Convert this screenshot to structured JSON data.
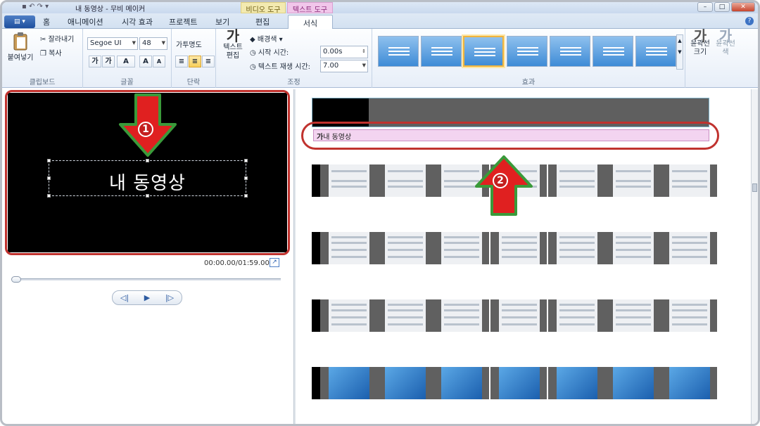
{
  "window": {
    "title": "내 동영상 - 무비 메이커",
    "quick_access": "▪ ↶ ↷ ▾",
    "controls": {
      "min": "–",
      "max": "□",
      "close": "✕"
    }
  },
  "context_tabs": {
    "video": "비디오 도구",
    "text": "텍스트 도구"
  },
  "tabs": [
    "홈",
    "애니메이션",
    "시각 효과",
    "프로젝트",
    "보기",
    "편집",
    "서식"
  ],
  "active_tab": "서식",
  "file_button": "▤ ▾",
  "help": "?",
  "ribbon": {
    "clipboard": {
      "label": "클립보드",
      "paste": "붙여넣기",
      "cut": "잘라내기",
      "copy": "복사"
    },
    "font": {
      "label": "글꼴",
      "family": "Segoe UI",
      "size": "48",
      "shrink": "가",
      "grow": "가",
      "color": "A",
      "bigger": "A",
      "smaller": "A"
    },
    "paragraph": {
      "label": "단락",
      "transparency": "투명도"
    },
    "adjust": {
      "label": "조정",
      "edit_text": "텍스트 편집",
      "bg_color": "배경색",
      "start_time_label": "시작 시간:",
      "start_time_value": "0.00s",
      "duration_label": "텍스트 재생 시간:",
      "duration_value": "7.00"
    },
    "effects": {
      "label": "효과",
      "selected_index": 2,
      "count": 7
    },
    "outline": {
      "size": "윤곽선 크기",
      "color": "윤곽선 색"
    }
  },
  "preview": {
    "caption_text": "내 동영상",
    "time": "00:00.00/01:59.00"
  },
  "storyboard": {
    "caption_clip": "내 동영상",
    "caption_icon": "가"
  },
  "annotations": {
    "one": "1",
    "two": "2"
  }
}
